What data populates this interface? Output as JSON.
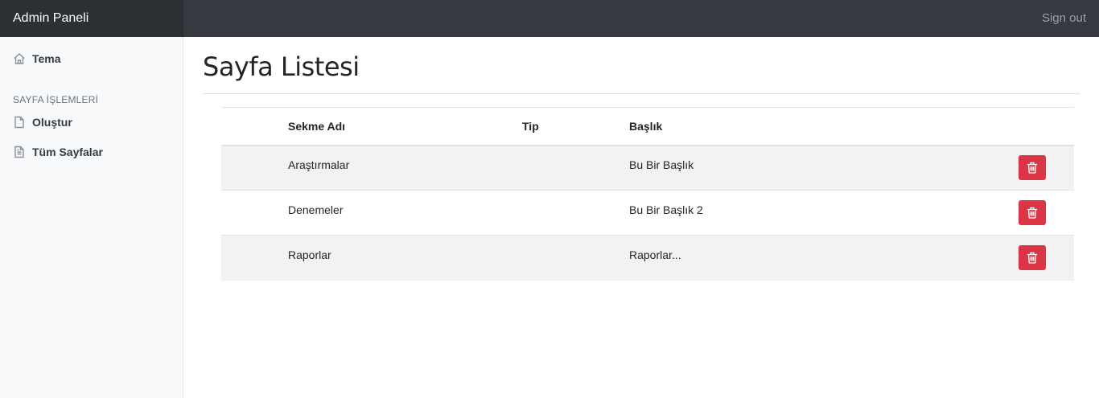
{
  "navbar": {
    "brand": "Admin Paneli",
    "signout_label": "Sign out"
  },
  "sidebar": {
    "top_items": [
      {
        "label": "Tema",
        "icon": "home-icon"
      }
    ],
    "section_heading": "SAYFA İŞLEMLERİ",
    "section_items": [
      {
        "label": "Oluştur",
        "icon": "file-icon"
      },
      {
        "label": "Tüm Sayfalar",
        "icon": "file-text-icon"
      }
    ]
  },
  "main": {
    "title": "Sayfa Listesi",
    "table": {
      "headers": [
        "",
        "Sekme Adı",
        "Tip",
        "Başlık",
        ""
      ],
      "rows": [
        {
          "tab_name": "Araştırmalar",
          "type": "",
          "heading": "Bu Bir Başlık"
        },
        {
          "tab_name": "Denemeler",
          "type": "",
          "heading": "Bu Bir Başlık 2"
        },
        {
          "tab_name": "Raporlar",
          "type": "",
          "heading": "Raporlar..."
        }
      ]
    }
  },
  "colors": {
    "navbar_bg": "#343a40",
    "brand_bg": "#2b3035",
    "sidebar_bg": "#f8f9fa",
    "delete_button": "#dc3545",
    "striped_row": "#f2f2f2"
  },
  "icons": {
    "delete": "trash-icon"
  }
}
